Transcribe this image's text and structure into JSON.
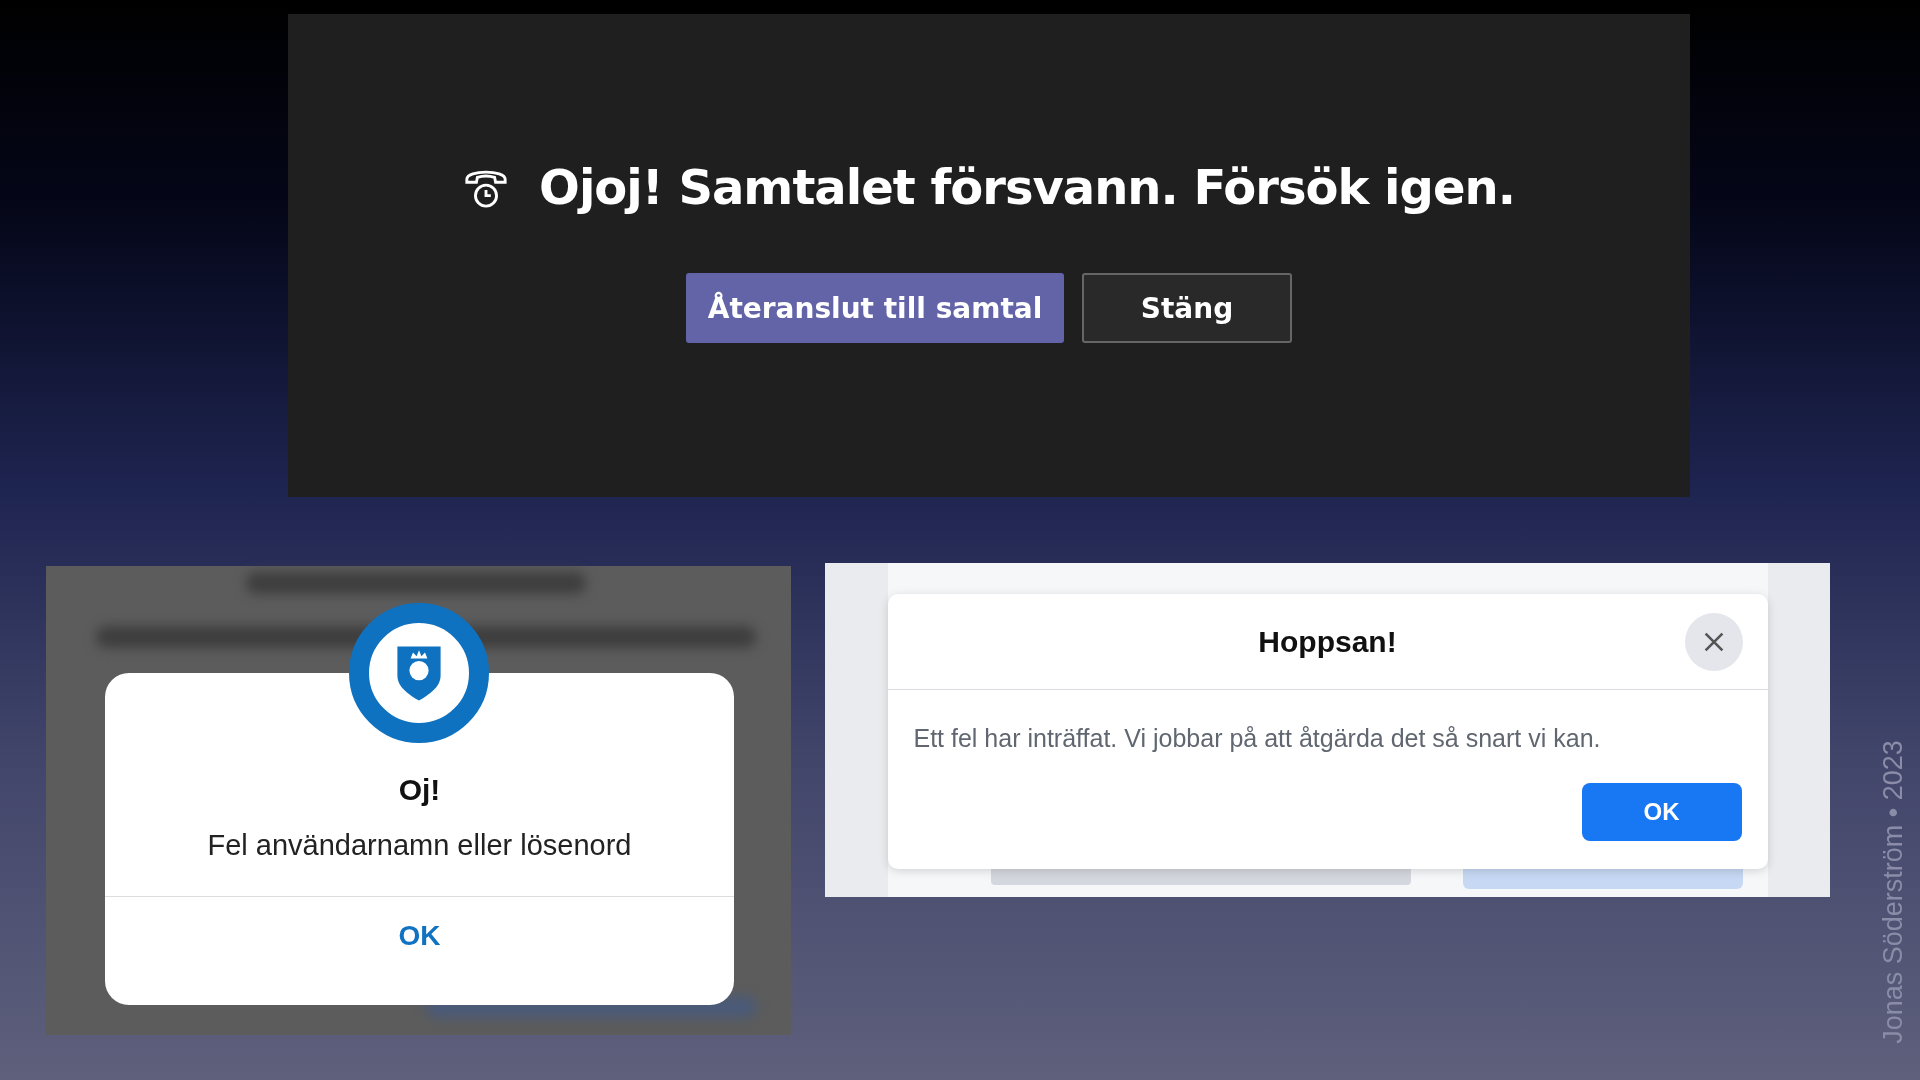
{
  "call_panel": {
    "title": "Ojoj! Samtalet försvann. Försök igen.",
    "buttons": [
      {
        "label": "Återanslut till samtal",
        "kind": "primary"
      },
      {
        "label": "Stäng",
        "kind": "secondary"
      }
    ]
  },
  "login_dialog": {
    "title": "Oj!",
    "message": "Fel användarnamn eller lösenord",
    "button": "OK"
  },
  "error_dialog": {
    "title": "Hoppsan!",
    "message": "Ett fel har inträffat. Vi jobbar på att åtgärda det så snart vi kan.",
    "button": "OK"
  },
  "credit": "Jonas Söderström • 2023"
}
